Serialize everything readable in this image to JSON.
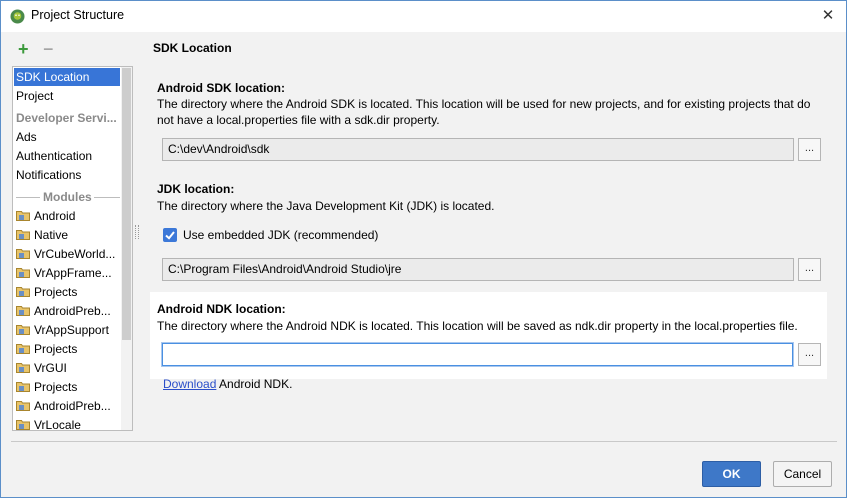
{
  "window": {
    "title": "Project Structure",
    "close_label": "✕"
  },
  "toolbar": {
    "add_label": "+",
    "remove_label": "−"
  },
  "sidebar": {
    "items": [
      {
        "label": "SDK Location",
        "selected": true
      },
      {
        "label": "Project"
      },
      {
        "label": "Developer Servi...",
        "muted": true
      },
      {
        "label": "Ads"
      },
      {
        "label": "Authentication"
      },
      {
        "label": "Notifications"
      }
    ],
    "modules_header": "Modules",
    "modules": [
      "Android",
      "Native",
      "VrCubeWorld...",
      "VrAppFrame...",
      "Projects",
      "AndroidPreb...",
      "VrAppSupport",
      "Projects",
      "VrGUI",
      "Projects",
      "AndroidPreb...",
      "VrLocale"
    ]
  },
  "main": {
    "section_title": "SDK Location",
    "android_sdk": {
      "label": "Android SDK location:",
      "description_line1": "The directory where the Android SDK is located. This location will be used for new projects, and for existing projects that do",
      "description_line2": "not have a local.properties file with a sdk.dir property.",
      "value": "C:\\dev\\Android\\sdk",
      "browse_label": "..."
    },
    "jdk": {
      "label": "JDK location:",
      "description": "The directory where the Java Development Kit (JDK) is located.",
      "checkbox_label": "Use embedded JDK (recommended)",
      "checkbox_checked": true,
      "value": "C:\\Program Files\\Android\\Android Studio\\jre",
      "browse_label": "..."
    },
    "ndk": {
      "label": "Android NDK location:",
      "description": "The directory where the Android NDK is located. This location will be saved as ndk.dir property in the local.properties file.",
      "value": "",
      "browse_label": "...",
      "download_link": "Download",
      "download_suffix": " Android NDK."
    }
  },
  "footer": {
    "ok_label": "OK",
    "cancel_label": "Cancel"
  },
  "colors": {
    "selection": "#3875d7",
    "primary_button": "#3e78c8",
    "link": "#2a4ec9",
    "add_icon": "#3c9a3c"
  }
}
